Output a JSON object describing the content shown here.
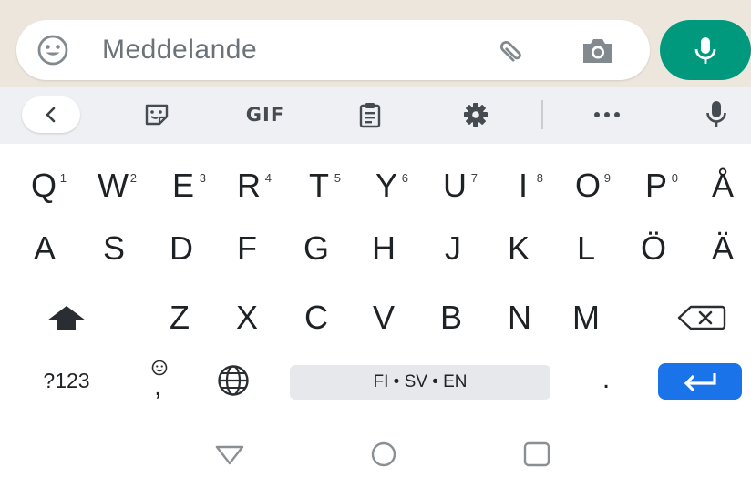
{
  "chat_input": {
    "placeholder": "Meddelande",
    "icons": [
      "smiley-icon",
      "paperclip-icon",
      "camera-icon",
      "microphone-icon"
    ]
  },
  "toolbar": {
    "gif_label": "GIF",
    "icons": [
      "chevron-left-icon",
      "sticker-icon",
      "clipboard-icon",
      "gear-icon",
      "more-icon",
      "microphone-icon"
    ]
  },
  "keyboard": {
    "row1": [
      {
        "label": "Q",
        "hint": "1"
      },
      {
        "label": "W",
        "hint": "2"
      },
      {
        "label": "E",
        "hint": "3"
      },
      {
        "label": "R",
        "hint": "4"
      },
      {
        "label": "T",
        "hint": "5"
      },
      {
        "label": "Y",
        "hint": "6"
      },
      {
        "label": "U",
        "hint": "7"
      },
      {
        "label": "I",
        "hint": "8"
      },
      {
        "label": "O",
        "hint": "9"
      },
      {
        "label": "P",
        "hint": "0"
      },
      {
        "label": "Å"
      }
    ],
    "row2": [
      "A",
      "S",
      "D",
      "F",
      "G",
      "H",
      "J",
      "K",
      "L",
      "Ö",
      "Ä"
    ],
    "row3": [
      "Z",
      "X",
      "C",
      "V",
      "B",
      "N",
      "M"
    ],
    "symbols_label": "?123",
    "comma_label": ",",
    "space_label": "FI • SV • EN",
    "period_label": ".",
    "icons": [
      "shift-icon",
      "backspace-icon",
      "emoji-icon",
      "globe-icon",
      "enter-icon"
    ]
  },
  "colors": {
    "accent_green": "#00997e",
    "enter_blue": "#1a73e8",
    "toolbar_bg": "#eef0f3",
    "chat_bg": "#ede6dc"
  },
  "navbar": {
    "icons": [
      "back-triangle-icon",
      "home-circle-icon",
      "recents-square-icon"
    ]
  }
}
